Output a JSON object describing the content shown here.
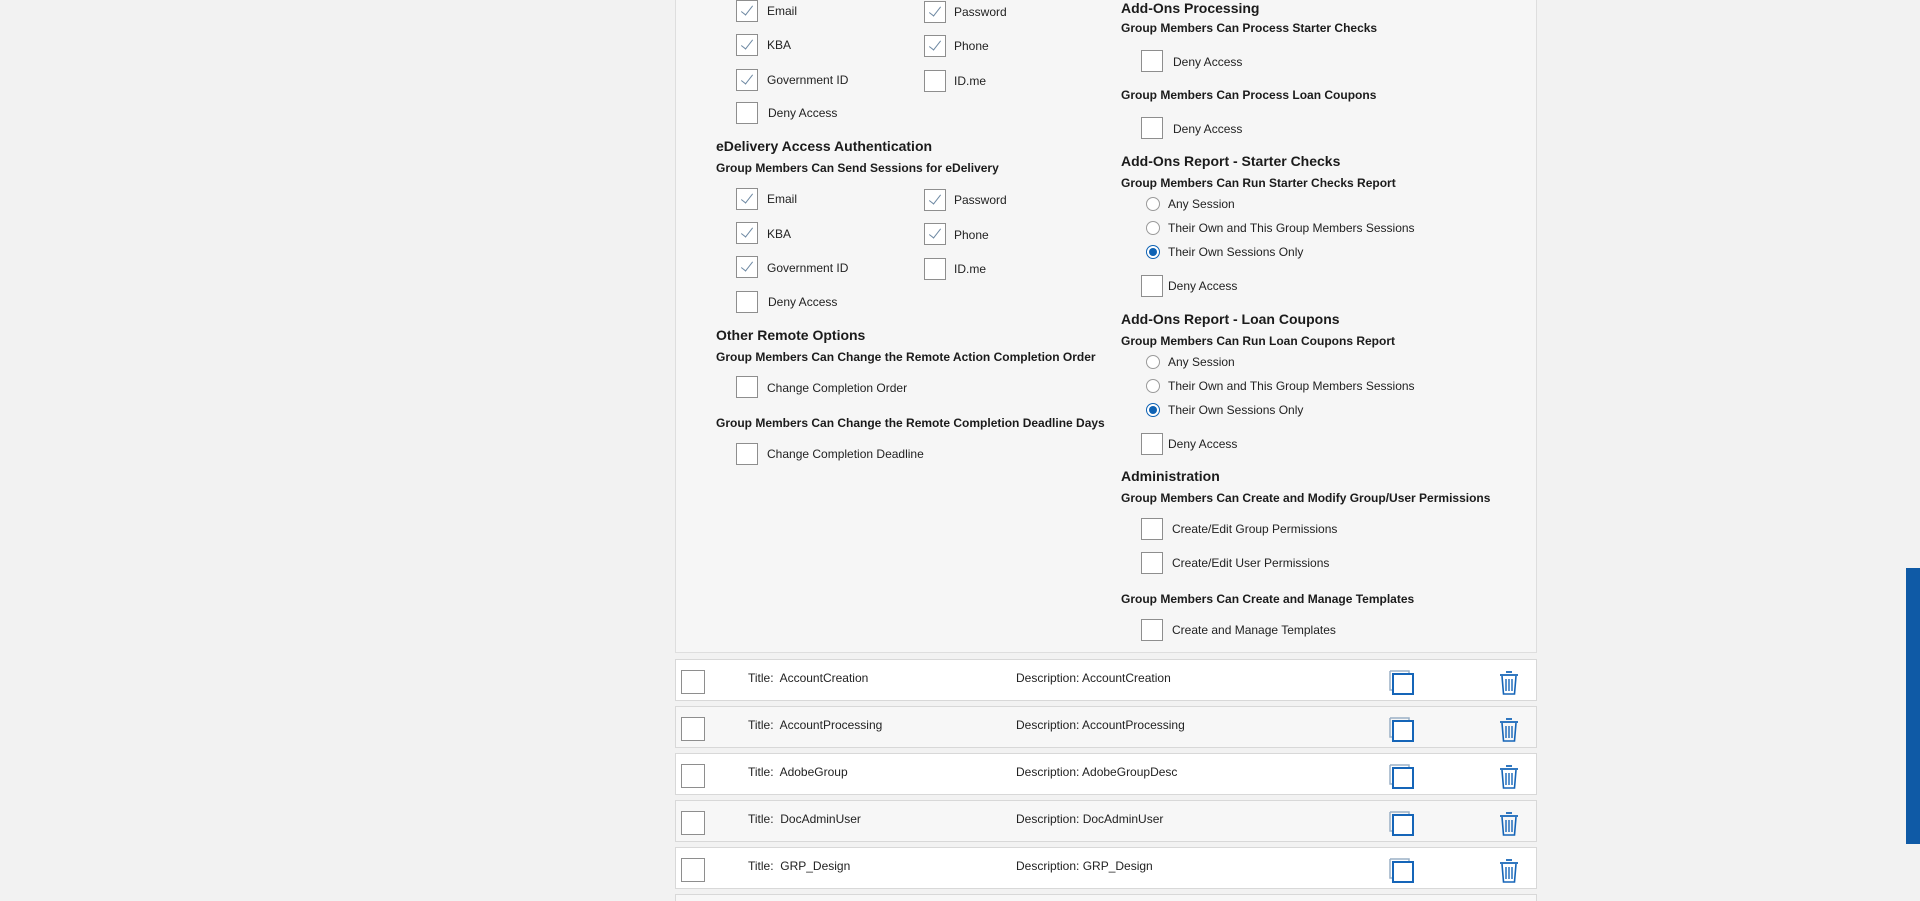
{
  "colors": {
    "accent": "#0f5aa6",
    "radio_selected": "#0e62b4",
    "check_mark": "#6e89a3"
  },
  "left_col": {
    "top_options": [
      {
        "label": "Email",
        "checked": true
      },
      {
        "label": "Password",
        "checked": true
      },
      {
        "label": "KBA",
        "checked": true
      },
      {
        "label": "Phone",
        "checked": true
      },
      {
        "label": "Government ID",
        "checked": true
      },
      {
        "label": "ID.me",
        "checked": false
      },
      {
        "label": "Deny Access",
        "checked": false
      }
    ],
    "edelivery": {
      "title": "eDelivery Access Authentication",
      "subtitle": "Group Members Can Send Sessions for eDelivery",
      "options": [
        {
          "label": "Email",
          "checked": true
        },
        {
          "label": "Password",
          "checked": true
        },
        {
          "label": "KBA",
          "checked": true
        },
        {
          "label": "Phone",
          "checked": true
        },
        {
          "label": "Government ID",
          "checked": true
        },
        {
          "label": "ID.me",
          "checked": false
        },
        {
          "label": "Deny Access",
          "checked": false
        }
      ]
    },
    "other_remote": {
      "title": "Other Remote Options",
      "sub1": "Group Members Can Change the Remote Action Completion Order",
      "opt1": "Change Completion Order",
      "sub2": "Group Members Can Change the Remote Completion Deadline Days",
      "opt2": "Change Completion Deadline"
    }
  },
  "right_col": {
    "addons_processing": {
      "title": "Add-Ons Processing",
      "sub1": "Group Members Can Process Starter Checks",
      "opt1": "Deny Access",
      "sub2": "Group Members Can Process Loan Coupons",
      "opt2": "Deny Access"
    },
    "report_starter": {
      "title": "Add-Ons Report - Starter Checks",
      "subtitle": "Group Members Can Run Starter Checks Report",
      "radios": [
        "Any Session",
        "Their Own and This Group Members Sessions",
        "Their Own Sessions Only"
      ],
      "selected": "Their Own Sessions Only",
      "deny": "Deny Access"
    },
    "report_loan": {
      "title": "Add-Ons Report - Loan Coupons",
      "subtitle": "Group Members Can Run Loan Coupons Report",
      "radios": [
        "Any Session",
        "Their Own and This Group Members Sessions",
        "Their Own Sessions Only"
      ],
      "selected": "Their Own Sessions Only",
      "deny": "Deny Access"
    },
    "administration": {
      "title": "Administration",
      "subtitle": "Group Members Can Create and Modify Group/User Permissions",
      "opt1": "Create/Edit Group Permissions",
      "opt2": "Create/Edit User Permissions",
      "sub2": "Group Members Can Create and Manage Templates",
      "opt3": "Create and Manage Templates"
    }
  },
  "groups": [
    {
      "title_label": "Title:",
      "title": "AccountCreation",
      "desc_label": "Description:",
      "desc": "AccountCreation"
    },
    {
      "title_label": "Title:",
      "title": "AccountProcessing",
      "desc_label": "Description:",
      "desc": "AccountProcessing"
    },
    {
      "title_label": "Title:",
      "title": "AdobeGroup",
      "desc_label": "Description:",
      "desc": "AdobeGroupDesc"
    },
    {
      "title_label": "Title:",
      "title": "DocAdminUser",
      "desc_label": "Description:",
      "desc": "DocAdminUser"
    },
    {
      "title_label": "Title:",
      "title": "GRP_Design",
      "desc_label": "Description:",
      "desc": "GRP_Design"
    }
  ]
}
